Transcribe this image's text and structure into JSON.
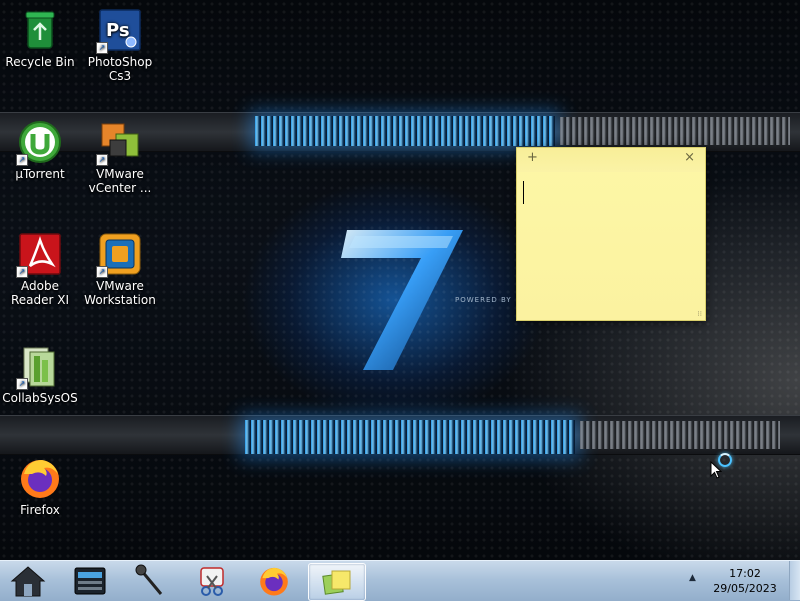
{
  "desktop": {
    "icons": [
      {
        "label": "Recycle Bin",
        "icon": "recycle-bin-icon"
      },
      {
        "label": "PhotoShop Cs3",
        "icon": "photoshop-icon",
        "badge": "Ps"
      },
      {
        "label": "µTorrent",
        "icon": "utorrent-icon"
      },
      {
        "label": "VMware vCenter ...",
        "icon": "vmware-vcenter-icon"
      },
      {
        "label": "Adobe Reader XI",
        "icon": "adobe-reader-icon"
      },
      {
        "label": "VMware Workstation",
        "icon": "vmware-workstation-icon"
      },
      {
        "label": "CollabSysOS",
        "icon": "collabsysos-icon"
      },
      {
        "label": "Firefox",
        "icon": "firefox-icon"
      }
    ],
    "wallpaper": {
      "text": "POWERED BY",
      "accent": "#2aa7ff"
    }
  },
  "sticky_note": {
    "add_label": "+",
    "close_label": "×",
    "content": "",
    "color": "#fbf2a0"
  },
  "taskbar": {
    "items": [
      {
        "icon": "home-icon"
      },
      {
        "icon": "scanner-icon"
      },
      {
        "icon": "microphone-icon"
      },
      {
        "icon": "snipping-tool-icon"
      },
      {
        "icon": "firefox-icon"
      },
      {
        "icon": "sticky-notes-icon",
        "active": true
      }
    ],
    "tray_arrow": "▲",
    "clock": {
      "time": "17:02",
      "date": "29/05/2023"
    }
  }
}
